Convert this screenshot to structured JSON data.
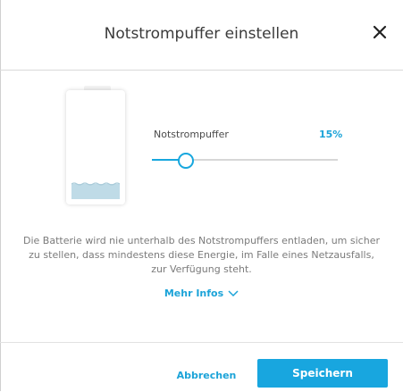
{
  "dialog": {
    "title": "Notstrompuffer einstellen",
    "close_icon": "close-icon"
  },
  "battery": {
    "fill_percent": 15,
    "fill_color": "#bfdbe7"
  },
  "slider": {
    "label": "Notstrompuffer",
    "value_text": "15%",
    "value_percent": 15,
    "accent_color": "#17a7de"
  },
  "description": "Die Batterie wird nie unterhalb des Notstrompuffers entladen, um sicher zu stellen, dass mindestens diese Energie, im Falle eines Netzausfalls, zur Verfügung steht.",
  "more_info": {
    "label": "Mehr Infos",
    "icon": "chevron-down-icon"
  },
  "footer": {
    "cancel_label": "Abbrechen",
    "save_label": "Speichern"
  }
}
